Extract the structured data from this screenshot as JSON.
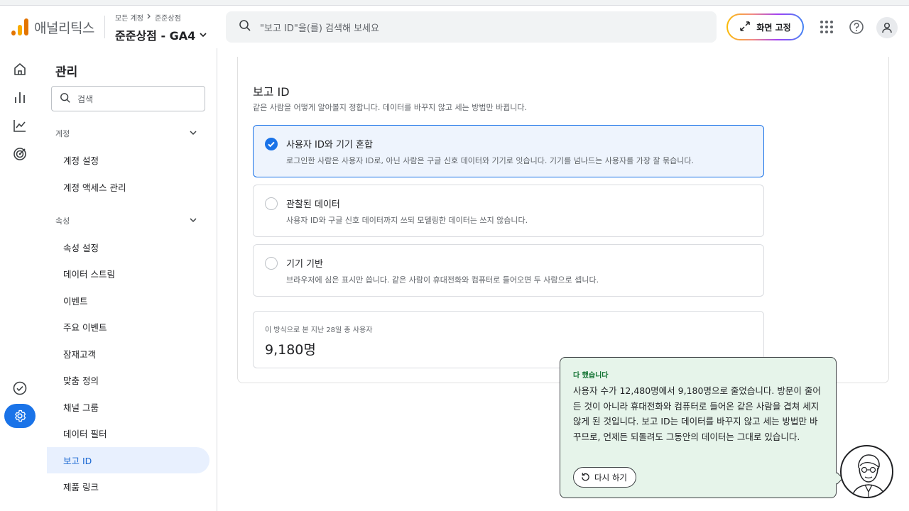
{
  "header": {
    "brand": "애널리틱스",
    "breadcrumb": [
      "모든 계정",
      "준준상점"
    ],
    "property": "준준상점 - GA4",
    "search_placeholder": "\"보고 ID\"을(를) 검색해 보세요",
    "pin_button": "화면 고정",
    "icons": [
      "apps-grid-icon",
      "help-icon",
      "account-icon"
    ]
  },
  "rail": {
    "icons": [
      "home-icon",
      "reports-icon",
      "explore-icon",
      "advertising-icon",
      "check-circle-icon",
      "admin-gear-icon"
    ],
    "active": "admin-gear-icon"
  },
  "nav": {
    "title": "관리",
    "search_placeholder": "검색",
    "sections": [
      {
        "label": "계정",
        "items": [
          "계정 설정",
          "계정 액세스 관리"
        ]
      },
      {
        "label": "속성",
        "items": [
          "속성 설정",
          "데이터 스트림",
          "이벤트",
          "주요 이벤트",
          "잠재고객",
          "맞춤 정의",
          "채널 그룹",
          "데이터 필터",
          "보고 ID",
          "제품 링크"
        ]
      }
    ],
    "active_item": "보고 ID"
  },
  "main": {
    "title": "보고 ID",
    "description": "같은 사람을 어떻게 알아볼지 정합니다. 데이터를 바꾸지 않고 세는 방법만 바뀝니다.",
    "options": [
      {
        "title": "사용자 ID와 기기 혼합",
        "description": "로그인한 사람은 사용자 ID로, 아닌 사람은 구글 신호 데이터와 기기로 잇습니다. 기기를 넘나드는 사용자를 가장 잘 묶습니다.",
        "selected": true
      },
      {
        "title": "관찰된 데이터",
        "description": "사용자 ID와 구글 신호 데이터까지 쓰되 모델링한 데이터는 쓰지 않습니다.",
        "selected": false
      },
      {
        "title": "기기 기반",
        "description": "브라우저에 심은 표시만 씁니다. 같은 사람이 휴대전화와 컴퓨터로 들어오면 두 사람으로 셉니다.",
        "selected": false
      }
    ],
    "stat": {
      "label": "이 방식으로 본 지난 28일 총 사용자",
      "value": "9,180명"
    }
  },
  "toast": {
    "title": "다 했습니다",
    "body": "사용자 수가 12,480명에서 9,180명으로 줄었습니다. 방문이 줄어든 것이 아니라 휴대전화와 컴퓨터로 들어온 같은 사람을 겹쳐 세지 않게 된 것입니다. 보고 ID는 데이터를 바꾸지 않고 세는 방법만 바꾸므로, 언제든 되돌려도 그동안의 데이터는 그대로 있습니다.",
    "retry_label": "다시 하기"
  },
  "colors": {
    "accent": "#1a73e8",
    "success_bg": "#e6f4ea",
    "success_text": "#137333",
    "logo_orange": "#f9ab00",
    "logo_dark": "#e37400"
  }
}
